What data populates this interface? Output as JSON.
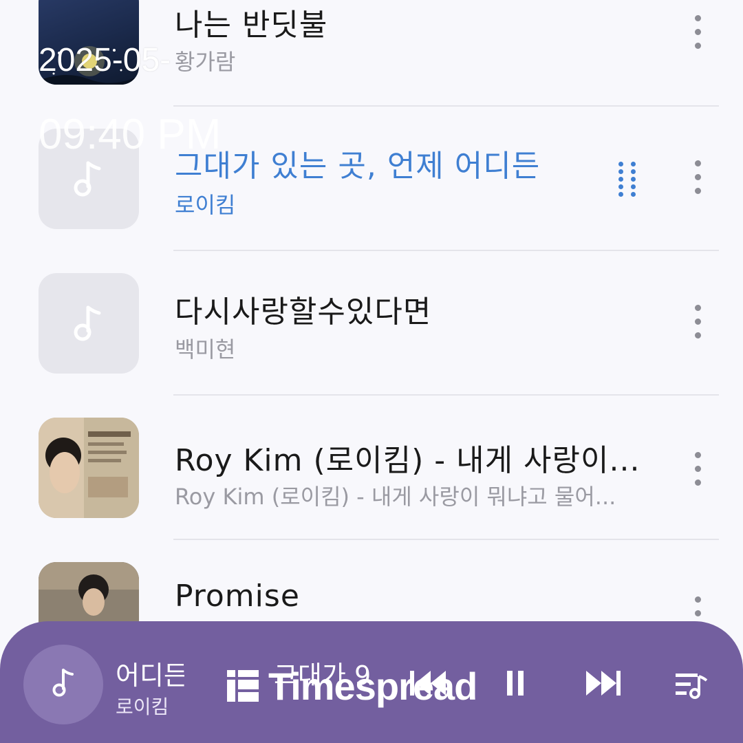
{
  "overlay": {
    "date": "2025-05-",
    "time": "09:40 PM"
  },
  "songs": [
    {
      "title": "나는 반딧불",
      "artist": "황가람",
      "art": "night-sky-firefly-cover",
      "active": false
    },
    {
      "title": "그대가 있는 곳, 언제 어디든",
      "artist": "로이킴",
      "art": "placeholder-note",
      "active": true
    },
    {
      "title": "다시사랑할수있다면",
      "artist": "백미현",
      "art": "placeholder-note",
      "active": false
    },
    {
      "title": "Roy Kim (로이킴) - 내게 사랑이...",
      "artist": "Roy Kim (로이킴) - 내게 사랑이 뭐냐고 물어...",
      "art": "roy-kim-album-cover",
      "active": false
    },
    {
      "title": "Promise",
      "artist": "",
      "art": "promise-cover",
      "active": false
    }
  ],
  "mini_player": {
    "title_fragment": "어디든",
    "title_lead": "그대가 9",
    "artist": "로이킴",
    "watermark": "Timespread",
    "colors": {
      "background": "#735f9f",
      "accent": "#3f7fd2"
    }
  }
}
